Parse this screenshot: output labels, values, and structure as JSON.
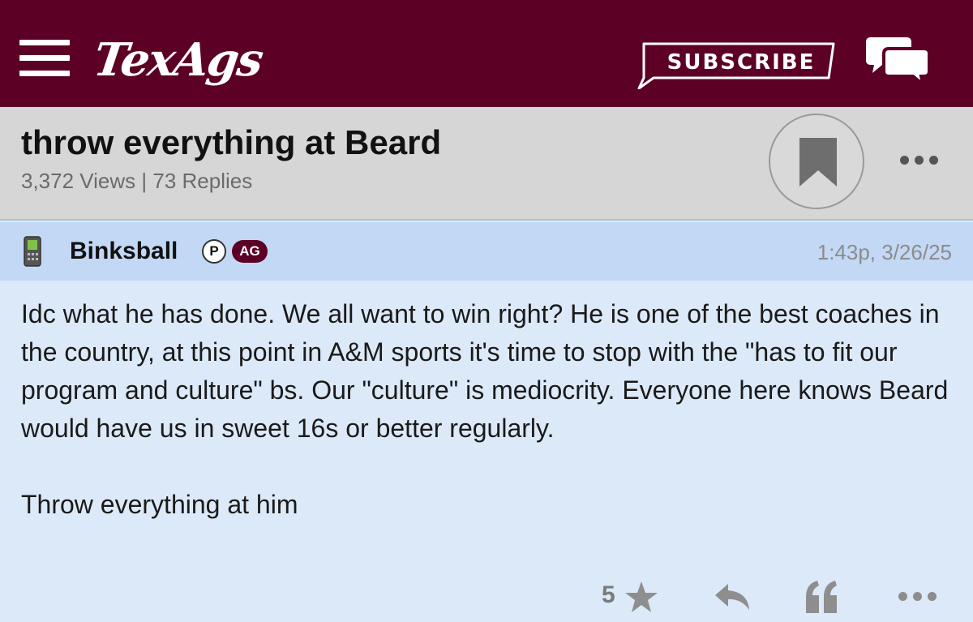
{
  "header": {
    "logo_text": "TexAgs",
    "subscribe_label": "SUBSCRIBE",
    "brand_color": "#5c0025",
    "icons": [
      "menu-icon",
      "chat-bubbles-icon"
    ]
  },
  "thread": {
    "title": "throw everything at Beard",
    "stats": "3,372 Views | 73 Replies",
    "icons": [
      "bookmark-icon",
      "more-options-icon"
    ]
  },
  "post": {
    "username": "Binksball",
    "badge_p": "P",
    "badge_ag": "AG",
    "timestamp": "1:43p, 3/26/25",
    "body": "Idc what he has done. We all want to win right? He is one of the best coaches in the country, at this point in A&M sports it's time to stop with the \"has to fit our program and culture\" bs. Our \"culture\" is mediocrity. Everyone here knows Beard would have us in sweet 16s or better regularly.\n\nThrow everything at him",
    "like_count": "5",
    "icons": [
      "phone-icon",
      "star-icon",
      "reply-icon",
      "quote-icon",
      "more-options-icon"
    ]
  }
}
